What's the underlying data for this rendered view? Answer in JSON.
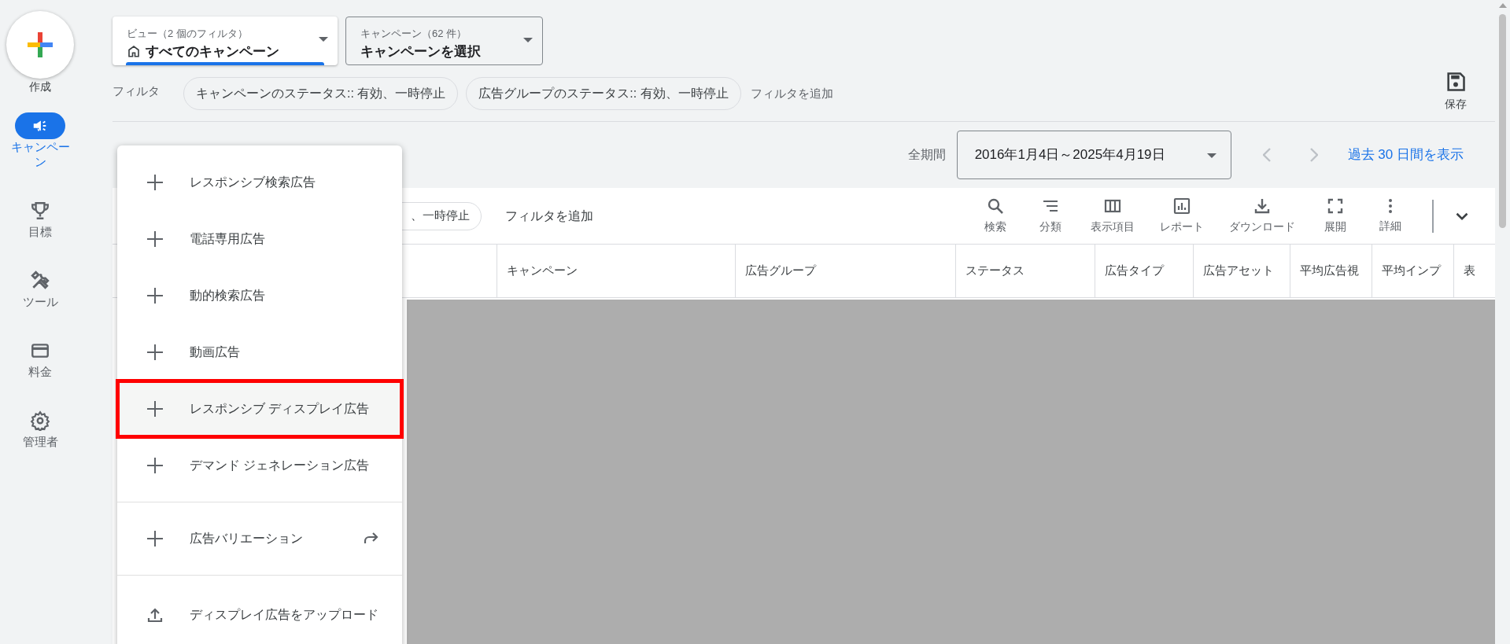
{
  "rail": {
    "create_label": "作成",
    "items": [
      {
        "label": "キャンペーン",
        "selected": true
      },
      {
        "label": "目標",
        "selected": false
      },
      {
        "label": "ツール",
        "selected": false
      },
      {
        "label": "料金",
        "selected": false
      },
      {
        "label": "管理者",
        "selected": false
      }
    ]
  },
  "view_selector": {
    "caption": "ビュー（2 個のフィルタ）",
    "value": "すべてのキャンペーン"
  },
  "campaign_selector": {
    "caption": "キャンペーン（62 件）",
    "value": "キャンペーンを選択"
  },
  "filters": {
    "label": "フィルタ",
    "chips": [
      "キャンペーンのステータス:: 有効、一時停止",
      "広告グループのステータス:: 有効、一時停止"
    ],
    "add": "フィルタを追加"
  },
  "save": {
    "label": "保存"
  },
  "date": {
    "label": "全期間",
    "range": "2016年1月4日～2025年4月19日",
    "link": "過去 30 日間を表示"
  },
  "table_toolbar": {
    "chip": "、一時停止",
    "add_filter": "フィルタを追加",
    "tools": [
      {
        "label": "検索"
      },
      {
        "label": "分類"
      },
      {
        "label": "表示項目"
      },
      {
        "label": "レポート"
      },
      {
        "label": "ダウンロード"
      },
      {
        "label": "展開"
      },
      {
        "label": "詳細"
      }
    ]
  },
  "table": {
    "columns": [
      "キャンペーン",
      "広告グループ",
      "ステータス",
      "広告タイプ",
      "広告アセット",
      "平均広告視",
      "平均インプ",
      "表"
    ]
  },
  "menu": {
    "items": [
      {
        "kind": "add",
        "label": "レスポンシブ検索広告",
        "selected": false
      },
      {
        "kind": "add",
        "label": "電話専用広告",
        "selected": false
      },
      {
        "kind": "add",
        "label": "動的検索広告",
        "selected": false
      },
      {
        "kind": "add",
        "label": "動画広告",
        "selected": false
      },
      {
        "kind": "add",
        "label": "レスポンシブ ディスプレイ広告",
        "selected": true
      },
      {
        "kind": "add",
        "label": "デマンド ジェネレーション広告",
        "selected": false
      },
      {
        "kind": "add_link",
        "label": "広告バリエーション",
        "selected": false
      },
      {
        "kind": "upload",
        "label": "ディスプレイ広告をアップロード",
        "selected": false
      }
    ]
  }
}
